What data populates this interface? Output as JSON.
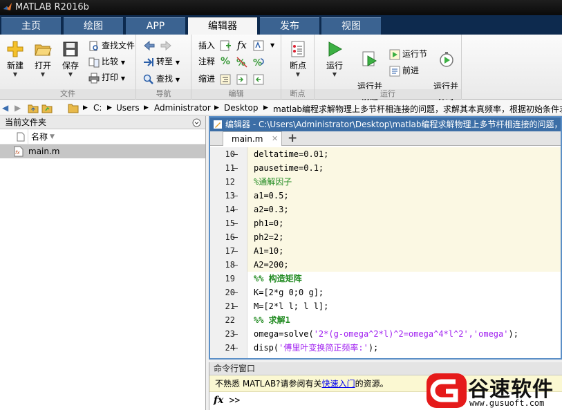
{
  "window": {
    "title": "MATLAB R2016b"
  },
  "main_tabs": [
    {
      "label": "主页"
    },
    {
      "label": "绘图"
    },
    {
      "label": "APP"
    },
    {
      "label": "编辑器",
      "active": true
    },
    {
      "label": "发布"
    },
    {
      "label": "视图"
    }
  ],
  "ribbon": {
    "file": {
      "group": "文件",
      "new": "新建",
      "open": "打开",
      "save": "保存",
      "find_files": "查找文件",
      "compare": "比较",
      "print": "打印"
    },
    "nav": {
      "group": "导航",
      "goto": "转至",
      "find": "查找"
    },
    "edit": {
      "group": "编辑",
      "insert": "插入",
      "comment": "注释",
      "indent": "缩进",
      "fx": "fx"
    },
    "breakpoints": {
      "group": "断点",
      "label": "断点"
    },
    "run": {
      "group": "运行",
      "run": "运行",
      "run_advance": "运行并\n前进",
      "run_section": "运行节",
      "advance": "前进",
      "run_time": "运行并\n计时"
    }
  },
  "address": {
    "crumbs": [
      "C:",
      "Users",
      "Administrator",
      "Desktop",
      "matlab编程求解物理上多节杆相连接的问题，求解其本真频率，根据初始条件求"
    ]
  },
  "file_browser": {
    "title": "当前文件夹",
    "column": "名称",
    "sort_indicator": "▼",
    "files": [
      {
        "name": "main.m"
      }
    ]
  },
  "editor": {
    "title": "编辑器 - C:\\Users\\Administrator\\Desktop\\matlab编程求解物理上多节杆相连接的问题，求",
    "tab": "main.m",
    "close_glyph": "✕",
    "add_glyph": "+",
    "lines": [
      {
        "n": "10",
        "dash": "–",
        "text": "deltatime=0.01;",
        "kind": "code",
        "hl": true
      },
      {
        "n": "11",
        "dash": "–",
        "text": "pausetime=0.1;",
        "kind": "code",
        "hl": true
      },
      {
        "n": "12",
        "dash": "",
        "text": "%通解因子",
        "kind": "comment",
        "hl": true
      },
      {
        "n": "13",
        "dash": "–",
        "text": "a1=0.5;",
        "kind": "code",
        "hl": true
      },
      {
        "n": "14",
        "dash": "–",
        "text": "a2=0.3;",
        "kind": "code",
        "hl": true
      },
      {
        "n": "15",
        "dash": "–",
        "text": "ph1=0;",
        "kind": "code",
        "hl": true
      },
      {
        "n": "16",
        "dash": "–",
        "text": "ph2=2;",
        "kind": "code",
        "hl": true
      },
      {
        "n": "17",
        "dash": "–",
        "text": "A1=10;",
        "kind": "code",
        "hl": true
      },
      {
        "n": "18",
        "dash": "–",
        "text": "A2=200;",
        "kind": "code",
        "hl": true
      },
      {
        "n": "19",
        "dash": "",
        "text": "%% 构造矩阵",
        "kind": "section",
        "hl": false
      },
      {
        "n": "20",
        "dash": "–",
        "text": "K=[2*g 0;0 g];",
        "kind": "code",
        "hl": false
      },
      {
        "n": "21",
        "dash": "–",
        "text": "M=[2*l l; l l];",
        "kind": "code",
        "hl": false
      },
      {
        "n": "22",
        "dash": "",
        "text": "%% 求解1",
        "kind": "section",
        "hl": false
      },
      {
        "n": "23",
        "dash": "–",
        "text_pre": "omega=solve(",
        "text_str": "'2*(g-omega^2*l)^2=omega^4*l^2','omega'",
        "text_post": ");",
        "kind": "mixed",
        "hl": false
      },
      {
        "n": "24",
        "dash": "–",
        "text_pre": "disp(",
        "text_str": "'傅里叶变换简正频率:'",
        "text_post": ");",
        "kind": "mixed",
        "hl": false
      }
    ]
  },
  "command_window": {
    "title": "命令行窗口",
    "notice_pre": "不熟悉 MATLAB?请参阅有关",
    "notice_link": "快速入门",
    "notice_post": "的资源。",
    "fx": "fx",
    "prompt": ">>"
  },
  "watermark": {
    "text": "谷速软件",
    "url": "www.gusuoft.com"
  },
  "colors": {
    "tab_active": "#f5f5f5",
    "tab_inactive": "#3b6391",
    "editor_title": "#3c6ea6",
    "section": "#228b22",
    "string": "#a020f0",
    "watermark_red": "#e51a1a"
  }
}
